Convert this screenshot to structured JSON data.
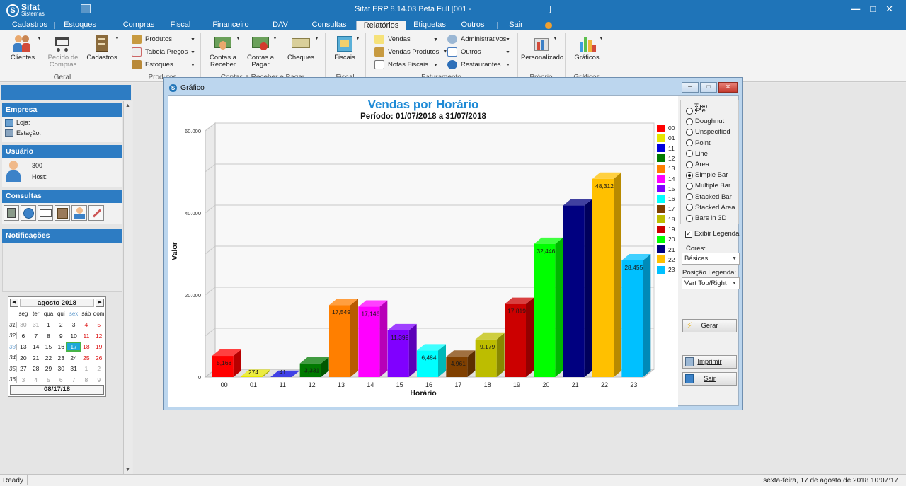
{
  "app": {
    "logo_name": "Sifat",
    "logo_sub": "Sistemas",
    "window_title": "Sifat ERP 8.14.03 Beta  Full  [001 -",
    "window_title_end": "]"
  },
  "menu": {
    "tabs": [
      "Cadastros",
      "Estoques",
      "Compras",
      "Fiscal",
      "Financeiro",
      "DAV",
      "Consultas",
      "Relatórios",
      "Etiquetas",
      "Outros",
      "Sair"
    ],
    "active": "Relatórios"
  },
  "ribbon": {
    "groups": {
      "geral": "Geral",
      "produtos": "Produtos",
      "contas": "Contas a Receber e Pagar",
      "fiscal": "Fiscal",
      "faturamento": "Faturamento",
      "proprio": "Próprio",
      "graficos": "Gráficos"
    },
    "clientes": "Clientes",
    "pedido_compras": "Pedido de Compras",
    "cadastros": "Cadastros",
    "produtos": "Produtos",
    "tabela_precos": "Tabela Preços",
    "estoques": "Estoques",
    "contas_receber": "Contas a Receber",
    "contas_pagar": "Contas a Pagar",
    "cheques": "Cheques",
    "fiscais": "Fiscais",
    "vendas": "Vendas",
    "vendas_produtos": "Vendas Produtos",
    "notas_fiscais": "Notas Fiscais",
    "administrativos": "Administrativos",
    "outros": "Outros",
    "restaurantes": "Restaurantes",
    "personalizado": "Personalizado",
    "graficos": "Gráficos"
  },
  "left": {
    "empresa_h": "Empresa",
    "loja": "Loja:",
    "estacao": "Estação:",
    "usuario_h": "Usuário",
    "user_id": "300",
    "host": "Host:",
    "consultas_h": "Consultas",
    "notificacoes_h": "Notificações"
  },
  "calendar": {
    "month": "agosto 2018",
    "headers": [
      "seg",
      "ter",
      "qua",
      "qui",
      "sex",
      "sáb",
      "dom"
    ],
    "weeks": [
      {
        "wk": "31",
        "days": [
          "30",
          "31",
          "1",
          "2",
          "3",
          "4",
          "5"
        ]
      },
      {
        "wk": "32",
        "days": [
          "6",
          "7",
          "8",
          "9",
          "10",
          "11",
          "12"
        ]
      },
      {
        "wk": "33",
        "days": [
          "13",
          "14",
          "15",
          "16",
          "17",
          "18",
          "19"
        ]
      },
      {
        "wk": "34",
        "days": [
          "20",
          "21",
          "22",
          "23",
          "24",
          "25",
          "26"
        ]
      },
      {
        "wk": "35",
        "days": [
          "27",
          "28",
          "29",
          "30",
          "31",
          "1",
          "2"
        ]
      },
      {
        "wk": "36",
        "days": [
          "3",
          "4",
          "5",
          "6",
          "7",
          "8",
          "9"
        ]
      }
    ],
    "selected": "08/17/18"
  },
  "status": {
    "left": "Ready",
    "right": "sexta-feira, 17 de agosto de 2018 10:07:17"
  },
  "grafico_window": {
    "title": "Gráfico",
    "tipo_label": "Tipo:",
    "tipos": [
      "Pie",
      "Doughnut",
      "Unspecified",
      "Point",
      "Line",
      "Area",
      "Simple Bar",
      "Multiple Bar",
      "Stacked Bar",
      "Stacked Area",
      "Bars in 3D"
    ],
    "tipo_selected": "Simple Bar",
    "exibir_legenda": "Exibir Legenda",
    "cores_label": "Cores:",
    "cores_value": "Básicas",
    "posicao_label": "Posição Legenda:",
    "posicao_value": "Vert Top/Right",
    "gerar": "Gerar",
    "imprimir": "Imprimir",
    "sair": "Sair"
  },
  "chart_data": {
    "type": "bar",
    "title": "Vendas por Horário",
    "subtitle": "Período: 01/07/2018 a 31/07/2018",
    "xlabel": "Horário",
    "ylabel": "Valor",
    "ylim": [
      0,
      60000
    ],
    "yticks": [
      0,
      20000,
      40000,
      60000
    ],
    "ytick_labels": [
      "0",
      "20.000",
      "40.000",
      "60.000"
    ],
    "categories": [
      "00",
      "01",
      "11",
      "12",
      "13",
      "14",
      "15",
      "16",
      "17",
      "18",
      "19",
      "20",
      "21",
      "22",
      "23"
    ],
    "values": [
      5168,
      274,
      41,
      3331,
      17549,
      17146,
      11399,
      6484,
      4961,
      9179,
      17819,
      32446,
      41800,
      48312,
      28455
    ],
    "labels": [
      "5,168",
      "274",
      "41",
      "3,331",
      "17,549",
      "17,146",
      "11,399",
      "6,484",
      "4,961",
      "9,179",
      "17,819",
      "32,446",
      "",
      "48,312",
      "28,455"
    ],
    "colors": [
      "#ff0000",
      "#e6e600",
      "#0000dd",
      "#007a00",
      "#ff7f00",
      "#ff00ff",
      "#8000ff",
      "#00ffff",
      "#804000",
      "#bdbd00",
      "#cc0000",
      "#00ff00",
      "#000080",
      "#ffc000",
      "#00c0ff"
    ],
    "legend_position": "top-right",
    "grid": true
  }
}
